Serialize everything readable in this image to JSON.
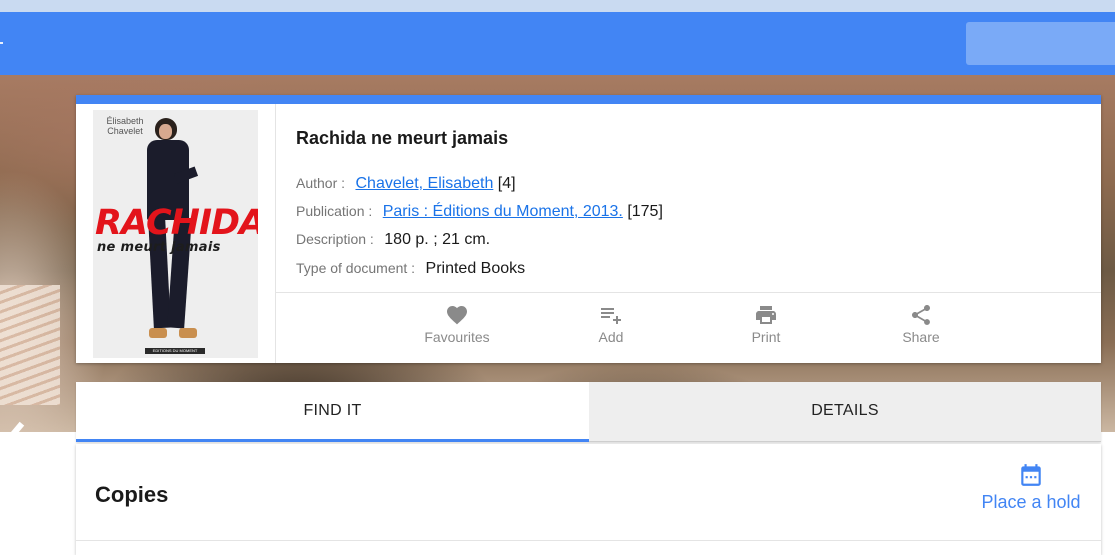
{
  "colors": {
    "app_bar": "#4285f4",
    "accent": "#4285f4",
    "link": "#1a73e8",
    "action_icon": "#8a8a8a",
    "tab_inactive_bg": "#eeeeee"
  },
  "book": {
    "title": "Rachida ne meurt jamais",
    "cover": {
      "author_line1": "Élisabeth",
      "author_line2": "Chavelet",
      "title": "RACHIDA",
      "subtitle": "ne meurt jamais",
      "publisher": "EDITIONS DU MOMENT"
    },
    "fields": {
      "author": {
        "label": "Author :",
        "link": "Chavelet, Elisabeth",
        "count": "[4]"
      },
      "publication": {
        "label": "Publication :",
        "link": "Paris : Éditions du Moment, 2013.",
        "count": "[175]"
      },
      "description": {
        "label": "Description :",
        "value": "180 p. ; 21 cm."
      },
      "type": {
        "label": "Type of document :",
        "value": "Printed Books"
      }
    }
  },
  "actions": [
    {
      "label": "Favourites",
      "icon": "heart-icon"
    },
    {
      "label": "Add",
      "icon": "playlist-add-icon"
    },
    {
      "label": "Print",
      "icon": "printer-icon"
    },
    {
      "label": "Share",
      "icon": "share-icon"
    }
  ],
  "tabs": [
    {
      "label": "FIND IT",
      "active": true
    },
    {
      "label": "DETAILS",
      "active": false
    }
  ],
  "copies": {
    "title": "Copies",
    "place_hold_label": "Place a hold",
    "place_hold_icon": "calendar-icon"
  }
}
